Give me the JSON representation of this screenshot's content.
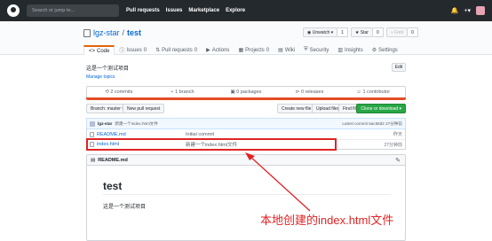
{
  "header": {
    "search_placeholder": "Search or jump to...",
    "nav": [
      "Pull requests",
      "Issues",
      "Marketplace",
      "Explore"
    ],
    "right_icons": [
      "bell-icon",
      "plus-icon",
      "avatar"
    ],
    "plus_label": "+▾"
  },
  "repo": {
    "owner": "lgz-star",
    "separator": "/",
    "name": "test",
    "watch_label": "Unwatch ▾",
    "watch_count": "1",
    "star_label": "Star",
    "star_count": "0",
    "fork_label": "Fork",
    "fork_count": "0"
  },
  "tabs": [
    {
      "label": "Code",
      "count": ""
    },
    {
      "label": "Issues",
      "count": "0"
    },
    {
      "label": "Pull requests",
      "count": "0"
    },
    {
      "label": "Actions",
      "count": ""
    },
    {
      "label": "Projects",
      "count": "0"
    },
    {
      "label": "Wiki",
      "count": ""
    },
    {
      "label": "Security",
      "count": ""
    },
    {
      "label": "Insights",
      "count": ""
    },
    {
      "label": "Settings",
      "count": ""
    }
  ],
  "description": "这是一个测试项目",
  "manage_topics": "Manage topics",
  "edit_label": "Edit",
  "stats": {
    "commits": "2 commits",
    "branch": "1 branch",
    "packages": "0 packages",
    "releases": "0 releases",
    "contributors": "1 contributor"
  },
  "branch": {
    "branch_label": "Branch: master ▾",
    "new_pr": "New pull request",
    "create_file": "Create new file",
    "upload_files": "Upload files",
    "find_file": "Find file",
    "clone": "Clone or download ▾"
  },
  "commit": {
    "author": "lgz-star",
    "message": "新建一个index.html文件",
    "latest": "Latest commit 5ac58d2 27分钟前"
  },
  "files": [
    {
      "name": "README.md",
      "message": "Initial commit",
      "age": "昨天"
    },
    {
      "name": "index.html",
      "message": "新建一个index.html文件",
      "age": "27分钟前"
    }
  ],
  "readme": {
    "header": "README.md",
    "title": "test",
    "body": "这是一个测试项目"
  },
  "annotation": {
    "text": "本地创建的index.html文件",
    "color": "#e02424"
  }
}
